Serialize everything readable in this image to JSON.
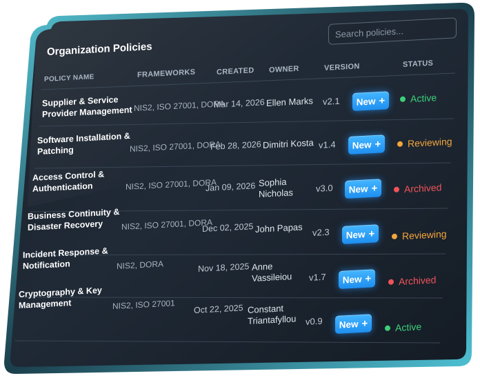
{
  "panel": {
    "title": "Organization Policies",
    "search_placeholder": "Search policies..."
  },
  "columns": {
    "policy_name": "POLICY NAME",
    "frameworks": "FRAMEWORKS",
    "created": "CREATED",
    "owner": "OWNER",
    "version": "VERSION",
    "status": "STATUS"
  },
  "new_button_label": "New",
  "colors": {
    "active": "#3ccf7a",
    "reviewing": "#f3a53b",
    "archived": "#f0535a",
    "button": "#2a9bf5"
  },
  "rows": [
    {
      "name_line1": "Supplier & Service",
      "name_line2": "Provider Management",
      "frameworks": "NIS2, ISO 27001, DORA",
      "created": "Mar 14, 2026",
      "owner_line1": "Ellen Marks",
      "owner_line2": "",
      "version": "v2.1",
      "status": "Active",
      "status_kind": "active"
    },
    {
      "name_line1": "Software Installation &",
      "name_line2": "Patching",
      "frameworks": "NIS2, ISO 27001, DORA",
      "created": "Feb 28, 2026",
      "owner_line1": "Dimitri Kosta",
      "owner_line2": "",
      "version": "v1.4",
      "status": "Reviewing",
      "status_kind": "reviewing"
    },
    {
      "name_line1": "Access Control &",
      "name_line2": "Authentication",
      "frameworks": "NIS2, ISO 27001, DORA",
      "created": "Jan 09, 2026",
      "owner_line1": "Sophia",
      "owner_line2": "Nicholas",
      "version": "v3.0",
      "status": "Archived",
      "status_kind": "archived"
    },
    {
      "name_line1": "Business Continuity &",
      "name_line2": "Disaster Recovery",
      "frameworks": "NIS2, ISO 27001, DORA",
      "created": "Dec 02, 2025",
      "owner_line1": "John Papas",
      "owner_line2": "",
      "version": "v2.3",
      "status": "Reviewing",
      "status_kind": "reviewing"
    },
    {
      "name_line1": "Incident Response &",
      "name_line2": "Notification",
      "frameworks": "NIS2, DORA",
      "created": "Nov 18, 2025",
      "owner_line1": "Anne",
      "owner_line2": "Vassileiou",
      "version": "v1.7",
      "status": "Archived",
      "status_kind": "archived"
    },
    {
      "name_line1": "Cryptography & Key",
      "name_line2": "Management",
      "frameworks": "NIS2, ISO 27001",
      "created": "Oct 22, 2025",
      "owner_line1": "Constant",
      "owner_line2": "Triantafyllou",
      "version": "v0.9",
      "status": "Active",
      "status_kind": "active"
    }
  ]
}
